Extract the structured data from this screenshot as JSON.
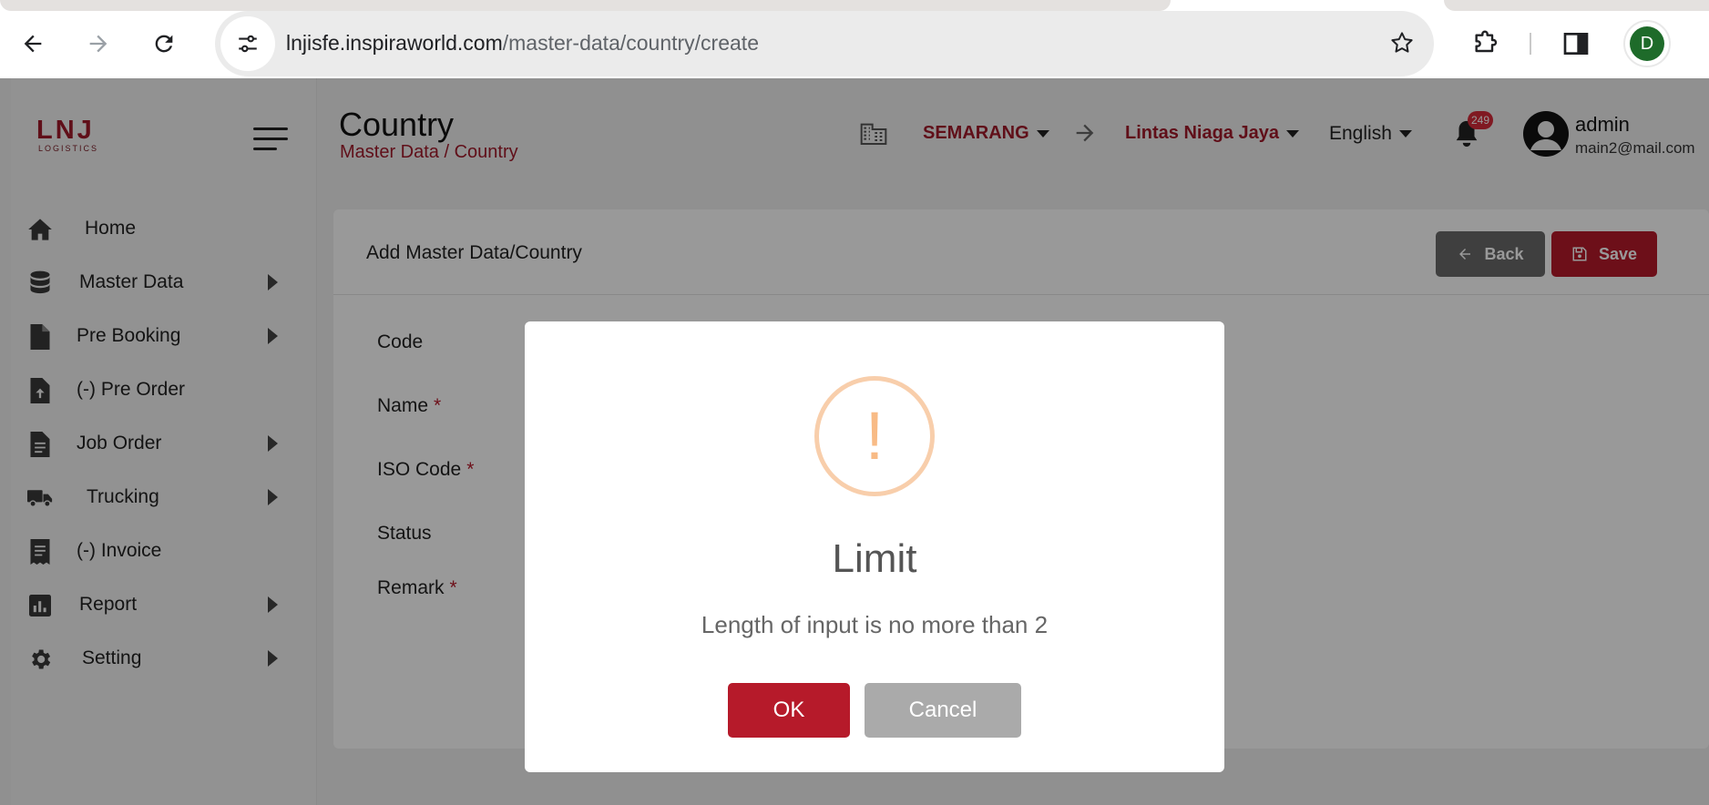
{
  "browser": {
    "url_domain": "lnjisfe.inspiraworld.com",
    "url_path": "/master-data/country/create",
    "profile_initial": "D"
  },
  "sidebar": {
    "logo_text": "LNJ",
    "logo_sub": "LOGISTICS",
    "items": [
      {
        "label": "Home",
        "icon": "home-icon",
        "has_submenu": false
      },
      {
        "label": "Master Data",
        "icon": "database-icon",
        "has_submenu": true
      },
      {
        "label": "Pre Booking",
        "icon": "file-icon",
        "has_submenu": true
      },
      {
        "label": "(-) Pre Order",
        "icon": "file-upload-icon",
        "has_submenu": false
      },
      {
        "label": "Job Order",
        "icon": "clipboard-icon",
        "has_submenu": true
      },
      {
        "label": "Trucking",
        "icon": "truck-icon",
        "has_submenu": true
      },
      {
        "label": "(-) Invoice",
        "icon": "invoice-icon",
        "has_submenu": false
      },
      {
        "label": "Report",
        "icon": "chart-icon",
        "has_submenu": true
      },
      {
        "label": "Setting",
        "icon": "gear-icon",
        "has_submenu": true
      }
    ]
  },
  "header": {
    "title": "Country",
    "breadcrumb": "Master Data / Country",
    "branch": "SEMARANG",
    "company": "Lintas Niaga Jaya",
    "language": "English",
    "notification_count": "249",
    "user_name": "admin",
    "user_email": "main2@mail.com"
  },
  "form": {
    "title": "Add Master Data/Country",
    "back_label": "Back",
    "save_label": "Save",
    "fields": [
      {
        "label": "Code",
        "required": false
      },
      {
        "label": "Name",
        "required": true
      },
      {
        "label": "ISO Code",
        "required": true
      },
      {
        "label": "Status",
        "required": false
      },
      {
        "label": "Remark",
        "required": true
      }
    ],
    "required_marker": "*"
  },
  "dialog": {
    "icon_glyph": "!",
    "title": "Limit",
    "message": "Length of input is no more than 2",
    "ok_label": "OK",
    "cancel_label": "Cancel"
  },
  "colors": {
    "brand_red": "#b61a2a",
    "warning": "#f8bb86"
  }
}
